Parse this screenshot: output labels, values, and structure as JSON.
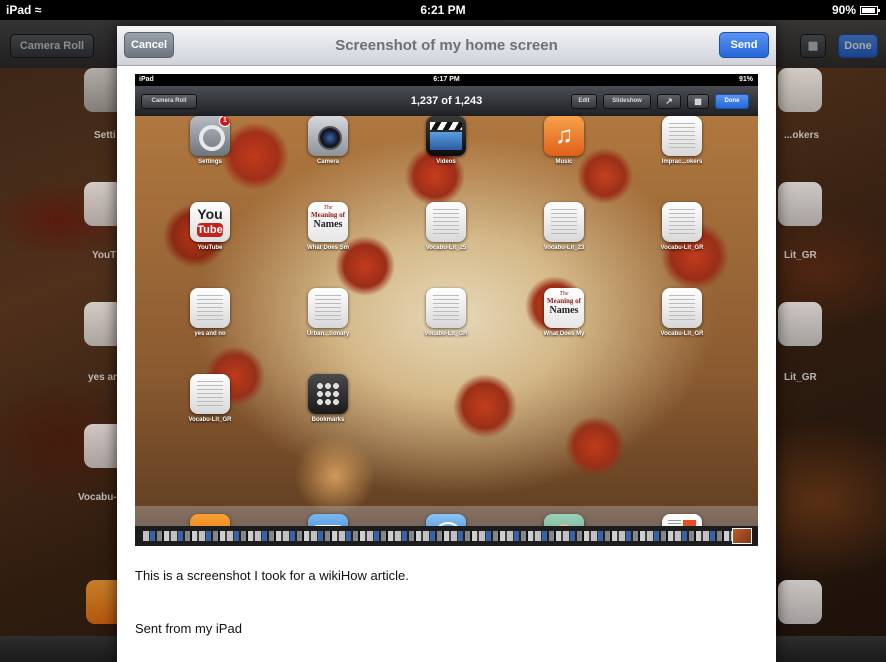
{
  "status_bar": {
    "carrier": "iPad",
    "time": "6:21 PM",
    "battery": "90%"
  },
  "background": {
    "camera_roll_label": "Camera Roll",
    "done_label": "Done",
    "side_labels": [
      "Setti",
      "YouT",
      "yes an",
      "Vocabu-",
      "...okers",
      "Lit_GR",
      "Lit_GR"
    ]
  },
  "compose": {
    "cancel_label": "Cancel",
    "title": "Screenshot of my home screen",
    "send_label": "Send",
    "body_line_1": "This is a screenshot I took for a wikiHow article.",
    "body_line_2": "Sent from my iPad"
  },
  "attachment": {
    "status": {
      "carrier": "iPad",
      "time": "6:17 PM",
      "battery": "91%"
    },
    "camera_roll_label": "Camera Roll",
    "counter": "1,237 of 1,243",
    "edit_label": "Edit",
    "slideshow_label": "Slideshow",
    "done_label": "Done",
    "settings_badge": "1",
    "apps": [
      {
        "label": "Settings",
        "icon": "settings-icon"
      },
      {
        "label": "Camera",
        "icon": "camera-icon"
      },
      {
        "label": "Videos",
        "icon": "videos-icon"
      },
      {
        "label": "Music",
        "icon": "music-icon"
      },
      {
        "label": "Imprac...okers",
        "icon": "document-icon"
      },
      {
        "label": "YouTube",
        "icon": "youtube-icon"
      },
      {
        "label": "What Does Sm",
        "icon": "meaning-of-names-icon"
      },
      {
        "label": "Vocabu-Lit_25",
        "icon": "document-icon"
      },
      {
        "label": "Vocabu-Lit_23",
        "icon": "document-icon"
      },
      {
        "label": "Vocabu-Lit_GR",
        "icon": "document-icon"
      },
      {
        "label": "yes and no",
        "icon": "document-icon"
      },
      {
        "label": "Urban...tionary",
        "icon": "document-icon"
      },
      {
        "label": "Vocabu-Lit_GR",
        "icon": "document-icon"
      },
      {
        "label": "What Does My",
        "icon": "meaning-of-names-icon"
      },
      {
        "label": "Vocabu-Lit_GR",
        "icon": "document-icon"
      },
      {
        "label": "Vocabu-Lit_GR",
        "icon": "document-icon"
      },
      {
        "label": "Bookmarks",
        "icon": "bookmarks-folder-icon"
      }
    ],
    "youtube_text_1": "You",
    "youtube_text_2": "Tube",
    "names_text_1": "The",
    "names_text_2": "Meaning of",
    "names_text_3": "Names",
    "dock_apps": [
      {
        "icon": "cbb-icon",
        "text": "CBB"
      },
      {
        "icon": "mail-icon"
      },
      {
        "icon": "safari-icon"
      },
      {
        "icon": "avatar-app-icon"
      },
      {
        "icon": "pages-icon"
      }
    ]
  },
  "colors": {
    "send_blue": "#2668d8",
    "nav_gray": "#dfe2e6",
    "title_gray": "#6c7077"
  }
}
